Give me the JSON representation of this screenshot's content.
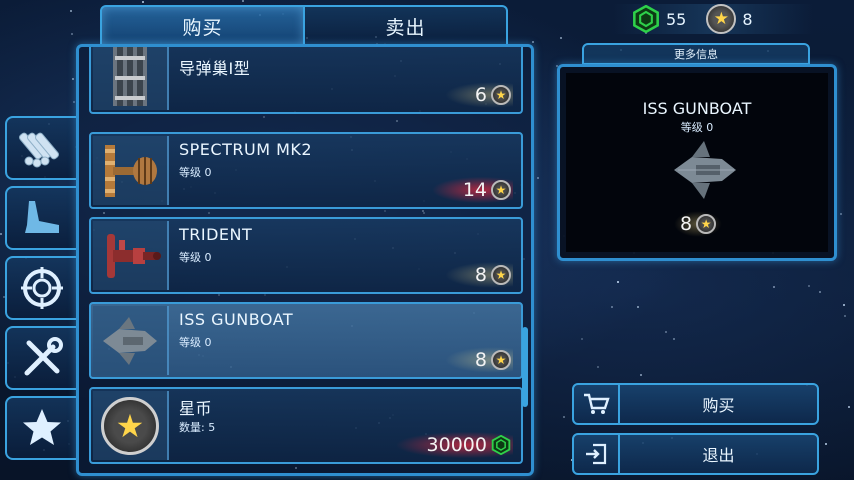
{
  "tabs": {
    "buy": "购买",
    "sell": "卖出"
  },
  "sidebar": [
    {
      "icon": "ammo-icon"
    },
    {
      "icon": "ship-fin-icon"
    },
    {
      "icon": "target-icon"
    },
    {
      "icon": "tools-icon"
    },
    {
      "icon": "star-icon"
    }
  ],
  "currency": {
    "gems": "55",
    "stars": "8"
  },
  "items": [
    {
      "name": "导弹巢Ⅰ型",
      "sub": "",
      "price": "6",
      "currency": "star",
      "price_style": "normal"
    },
    {
      "name": "SPECTRUM MK2",
      "sub": "等级 0",
      "price": "14",
      "currency": "star",
      "price_style": "insufficient"
    },
    {
      "name": "TRIDENT",
      "sub": "等级 0",
      "price": "8",
      "currency": "star",
      "price_style": "normal"
    },
    {
      "name": "ISS GUNBOAT",
      "sub": "等级 0",
      "price": "8",
      "currency": "star",
      "price_style": "normal",
      "selected": true
    },
    {
      "name": "星币",
      "sub": "数量: 5",
      "price": "30000",
      "currency": "gem",
      "price_style": "insufficient"
    }
  ],
  "info": {
    "header": "更多信息",
    "name": "ISS GUNBOAT",
    "level": "等级 0",
    "price": "8"
  },
  "actions": {
    "buy": "购买",
    "exit": "退出"
  },
  "colors": {
    "accent": "#3aa3e0",
    "gem": "#2ed14a",
    "star": "#ffd54a",
    "insufficient": "#ff2a40"
  }
}
